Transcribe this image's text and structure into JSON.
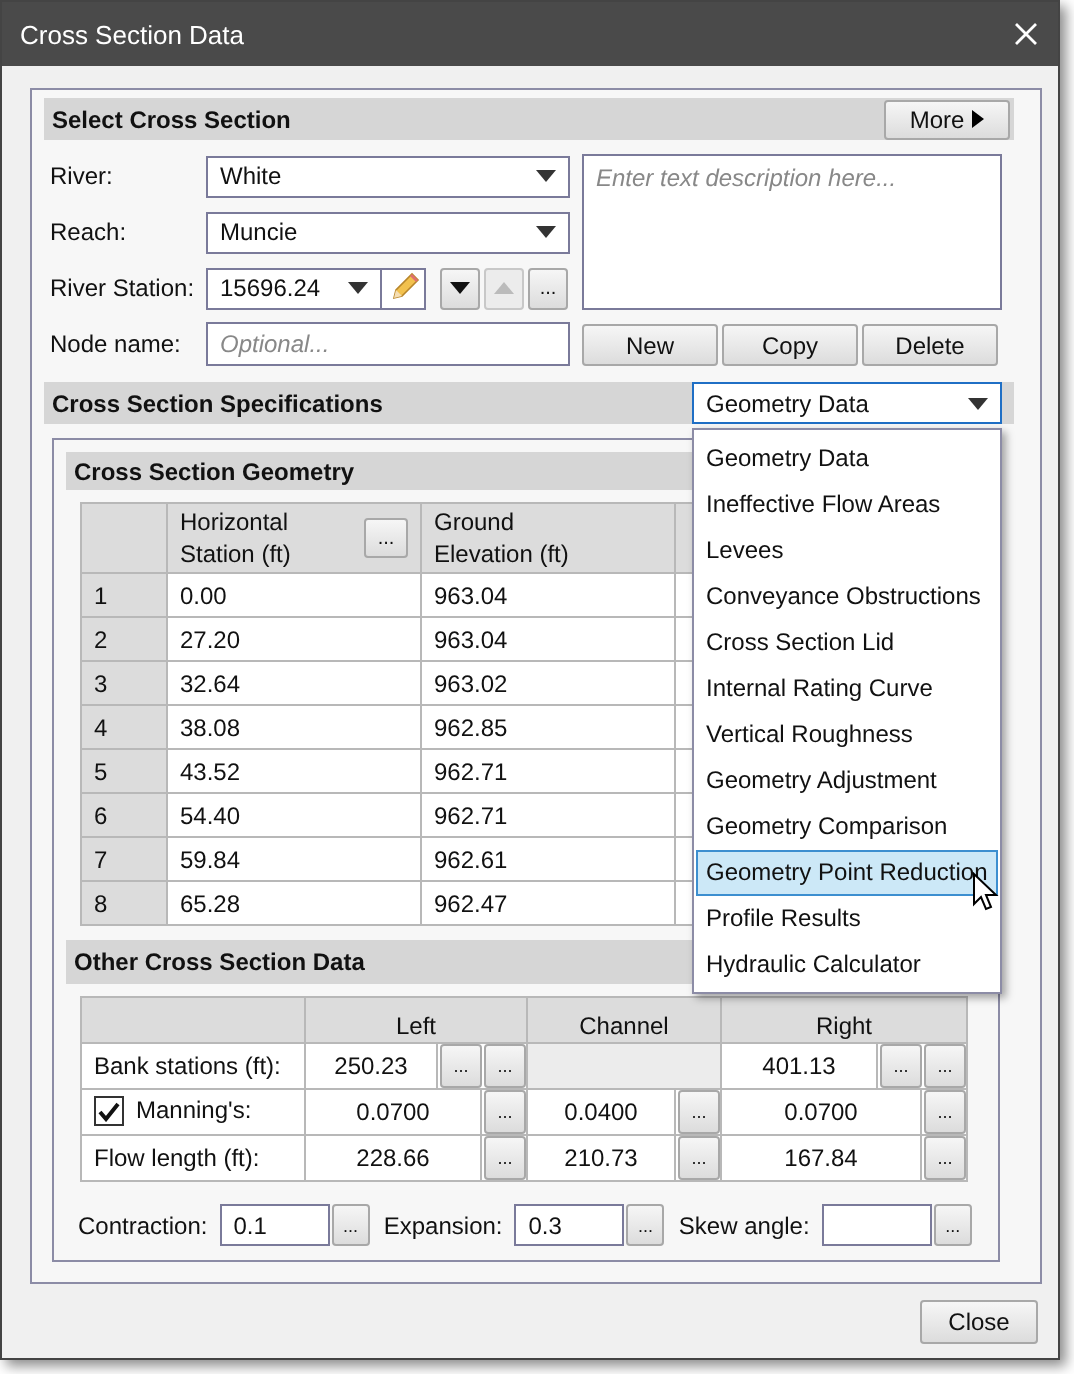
{
  "window": {
    "title": "Cross Section Data"
  },
  "select_section": {
    "title": "Select Cross Section",
    "more_button": "More",
    "fields": [
      {
        "label": "River:",
        "value": "White"
      },
      {
        "label": "Reach:",
        "value": "Muncie"
      }
    ],
    "river_station": {
      "label": "River Station:",
      "value": "15696.24",
      "nav_buttons": [
        {
          "kind": "down",
          "disabled": false
        },
        {
          "kind": "up",
          "disabled": true
        },
        {
          "kind": "more",
          "label": "...",
          "disabled": false
        }
      ]
    },
    "node_name": {
      "label": "Node name:",
      "placeholder": "Optional..."
    },
    "description": {
      "placeholder": "Enter text description here..."
    },
    "buttons": [
      "New",
      "Copy",
      "Delete"
    ]
  },
  "specifications": {
    "title": "Cross Section Specifications",
    "view": {
      "value": "Geometry Data",
      "expanded": true,
      "options": [
        {
          "label": "Geometry Data",
          "highlighted": false
        },
        {
          "label": "Ineffective Flow Areas",
          "highlighted": false
        },
        {
          "label": "Levees",
          "highlighted": false
        },
        {
          "label": "Conveyance Obstructions",
          "highlighted": false
        },
        {
          "label": "Cross Section Lid",
          "highlighted": false
        },
        {
          "label": "Internal Rating Curve",
          "highlighted": false
        },
        {
          "label": "Vertical Roughness",
          "highlighted": false
        },
        {
          "label": "Geometry Adjustment",
          "highlighted": false
        },
        {
          "label": "Geometry Comparison",
          "highlighted": false
        },
        {
          "label": "Geometry Point Reduction",
          "highlighted": true
        },
        {
          "label": "Profile Results",
          "highlighted": false
        },
        {
          "label": "Hydraulic Calculator",
          "highlighted": false
        }
      ]
    }
  },
  "geometry": {
    "title": "Cross Section Geometry",
    "columns": [
      {},
      {
        "label": "Horizontal Station (ft)",
        "button": "..."
      },
      {
        "label": "Ground Elevation (ft)"
      }
    ],
    "rows": [
      [
        "1",
        "0.00",
        "963.04"
      ],
      [
        "2",
        "27.20",
        "963.04"
      ],
      [
        "3",
        "32.64",
        "963.02"
      ],
      [
        "4",
        "38.08",
        "962.85"
      ],
      [
        "5",
        "43.52",
        "962.71"
      ],
      [
        "6",
        "54.40",
        "962.71"
      ],
      [
        "7",
        "59.84",
        "962.61"
      ],
      [
        "8",
        "65.28",
        "962.47"
      ]
    ]
  },
  "other": {
    "title": "Other Cross Section Data",
    "columns": [
      "Left",
      "Channel",
      "Right"
    ],
    "rows": [
      {
        "kind": "bank",
        "label": "Bank stations (ft):",
        "cells": [
          {
            "value": "250.23",
            "buttons": [
              "...",
              "..."
            ]
          },
          {
            "kind": "blank"
          },
          {
            "value": "401.13",
            "buttons": [
              "...",
              "..."
            ]
          }
        ]
      },
      {
        "kind": "check",
        "label": "Manning's:",
        "checked": true,
        "cells": [
          {
            "value": "0.0700",
            "buttons": [
              "..."
            ]
          },
          {
            "value": "0.0400",
            "buttons": [
              "..."
            ]
          },
          {
            "value": "0.0700",
            "buttons": [
              "..."
            ]
          }
        ]
      },
      {
        "kind": "plain",
        "label": "Flow length (ft):",
        "cells": [
          {
            "value": "228.66",
            "buttons": [
              "..."
            ]
          },
          {
            "value": "210.73",
            "buttons": [
              "..."
            ]
          },
          {
            "value": "167.84",
            "buttons": [
              "..."
            ]
          }
        ]
      }
    ],
    "coefficients": [
      {
        "label": "Contraction:",
        "value": "0.1",
        "button": "..."
      },
      {
        "label": "Expansion:",
        "value": "0.3",
        "button": "..."
      },
      {
        "label": "Skew angle:",
        "button": "..."
      }
    ]
  },
  "close_button": "Close"
}
